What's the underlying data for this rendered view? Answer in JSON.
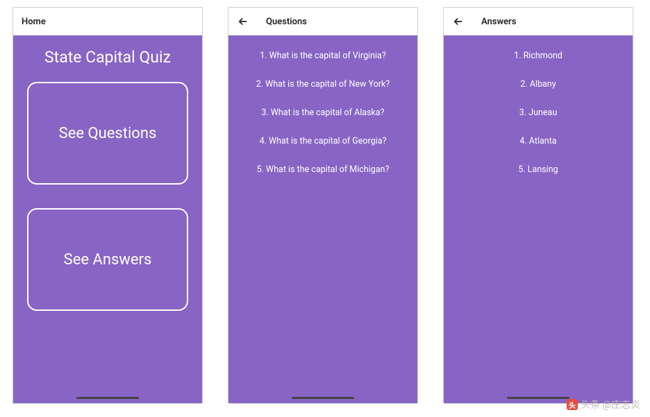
{
  "screens": {
    "home": {
      "appbar_title": "Home",
      "page_title": "State Capital Quiz",
      "btn_questions": "See Questions",
      "btn_answers": "See Answers"
    },
    "questions": {
      "appbar_title": "Questions",
      "items": [
        "1. What is the capital of Virginia?",
        "2. What is the capital of New York?",
        "3. What is the capital of Alaska?",
        "4. What is the capital of Georgia?",
        "5. What is the capital of Michigan?"
      ]
    },
    "answers": {
      "appbar_title": "Answers",
      "items": [
        "1. Richmond",
        "2. Albany",
        "3. Juneau",
        "4. Atlanta",
        "5. Lansing"
      ]
    }
  },
  "watermark": "头条 @庄志炎"
}
